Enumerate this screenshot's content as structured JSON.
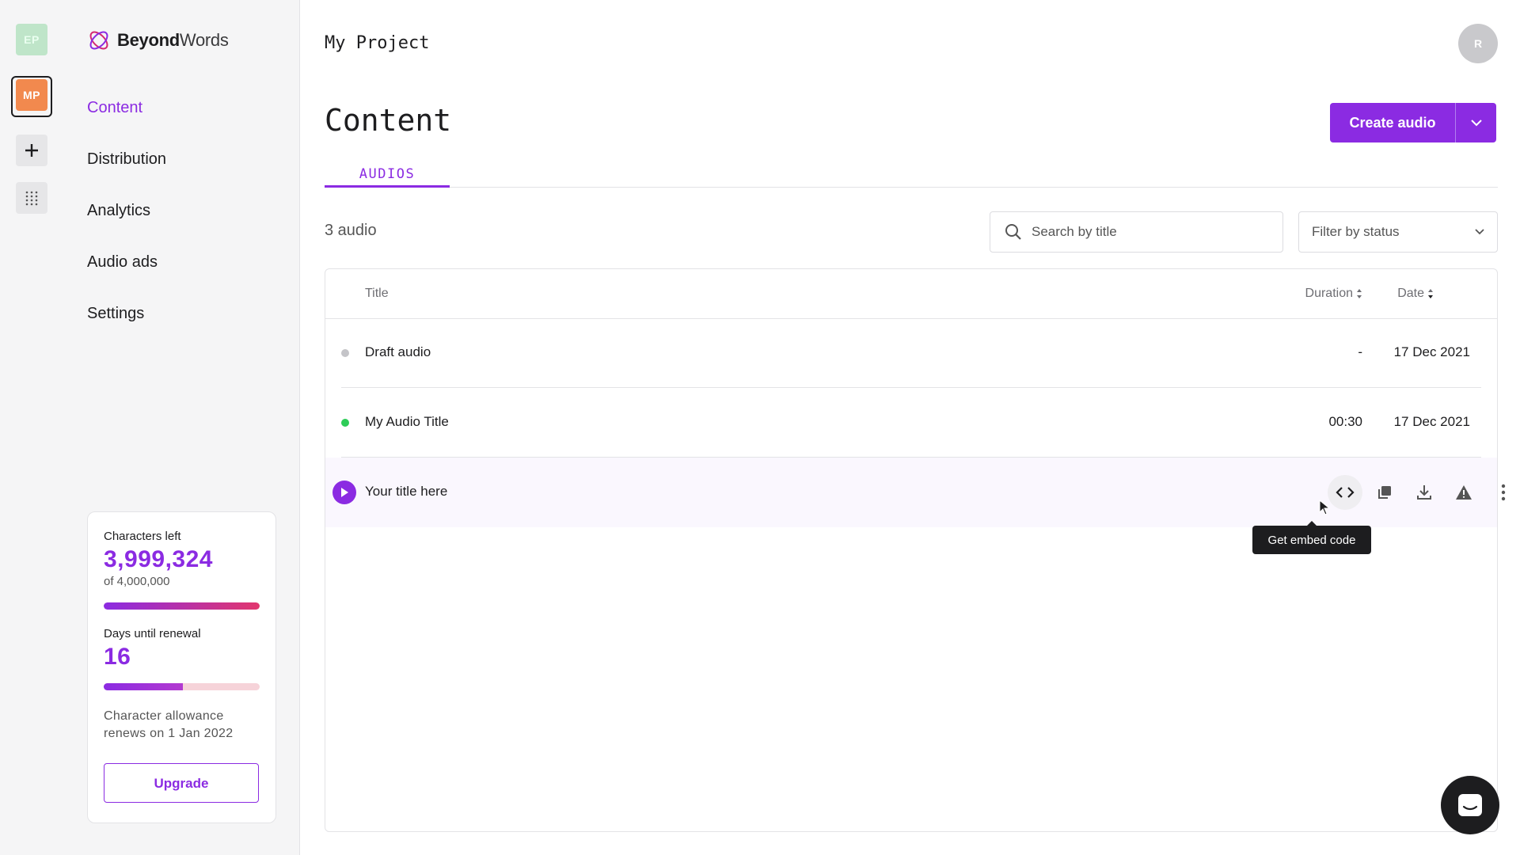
{
  "rail": {
    "projects": [
      {
        "initials": "EP",
        "color": "#bfe5c9"
      },
      {
        "initials": "MP",
        "color": "#f2894e",
        "active": true
      }
    ]
  },
  "brand": {
    "name_part1": "Beyond",
    "name_part2": "Words"
  },
  "nav": {
    "items": [
      {
        "label": "Content",
        "active": true
      },
      {
        "label": "Distribution"
      },
      {
        "label": "Analytics"
      },
      {
        "label": "Audio ads"
      },
      {
        "label": "Settings"
      }
    ]
  },
  "usage": {
    "chars_label": "Characters left",
    "chars_value": "3,999,324",
    "chars_total": "of 4,000,000",
    "chars_fraction": 0.9998,
    "days_label": "Days until renewal",
    "days_value": "16",
    "days_fraction": 0.51,
    "note": "Character allowance renews on 1 Jan 2022",
    "upgrade_label": "Upgrade"
  },
  "header": {
    "project": "My Project",
    "avatar_initial": "R"
  },
  "page": {
    "title": "Content",
    "create_label": "Create audio",
    "tab": "AUDIOS",
    "count": "3 audio",
    "search_placeholder": "Search by title",
    "filter_label": "Filter by status"
  },
  "table": {
    "columns": {
      "title": "Title",
      "duration": "Duration",
      "date": "Date"
    },
    "rows": [
      {
        "title": "Draft audio",
        "duration": "-",
        "date": "17 Dec 2021",
        "status_color": "#c4c4c8"
      },
      {
        "title": "My Audio Title",
        "duration": "00:30",
        "date": "17 Dec 2021",
        "status_color": "#2ecc58"
      },
      {
        "title": "Your title here",
        "duration": "",
        "date": ""
      }
    ]
  },
  "tooltip": "Get embed code",
  "colors": {
    "accent": "#8b2be2",
    "pink": "#e2366e"
  }
}
